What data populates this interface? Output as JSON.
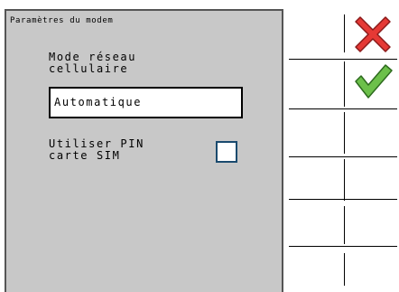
{
  "dialog": {
    "title": "Paramètres du modem",
    "network_mode_label": "Mode réseau\ncellulaire",
    "network_mode_value": "Automatique",
    "use_pin_label": "Utiliser PIN\ncarte SIM",
    "use_pin_checked": false
  },
  "softkeys": {
    "cancel_icon": "cancel-x-icon",
    "confirm_icon": "confirm-check-icon",
    "cancel_color": "#e53935",
    "confirm_color": "#6cc04a"
  },
  "colors": {
    "dialog_background": "#c8c8c8",
    "checkbox_border": "#1a4a6e"
  }
}
